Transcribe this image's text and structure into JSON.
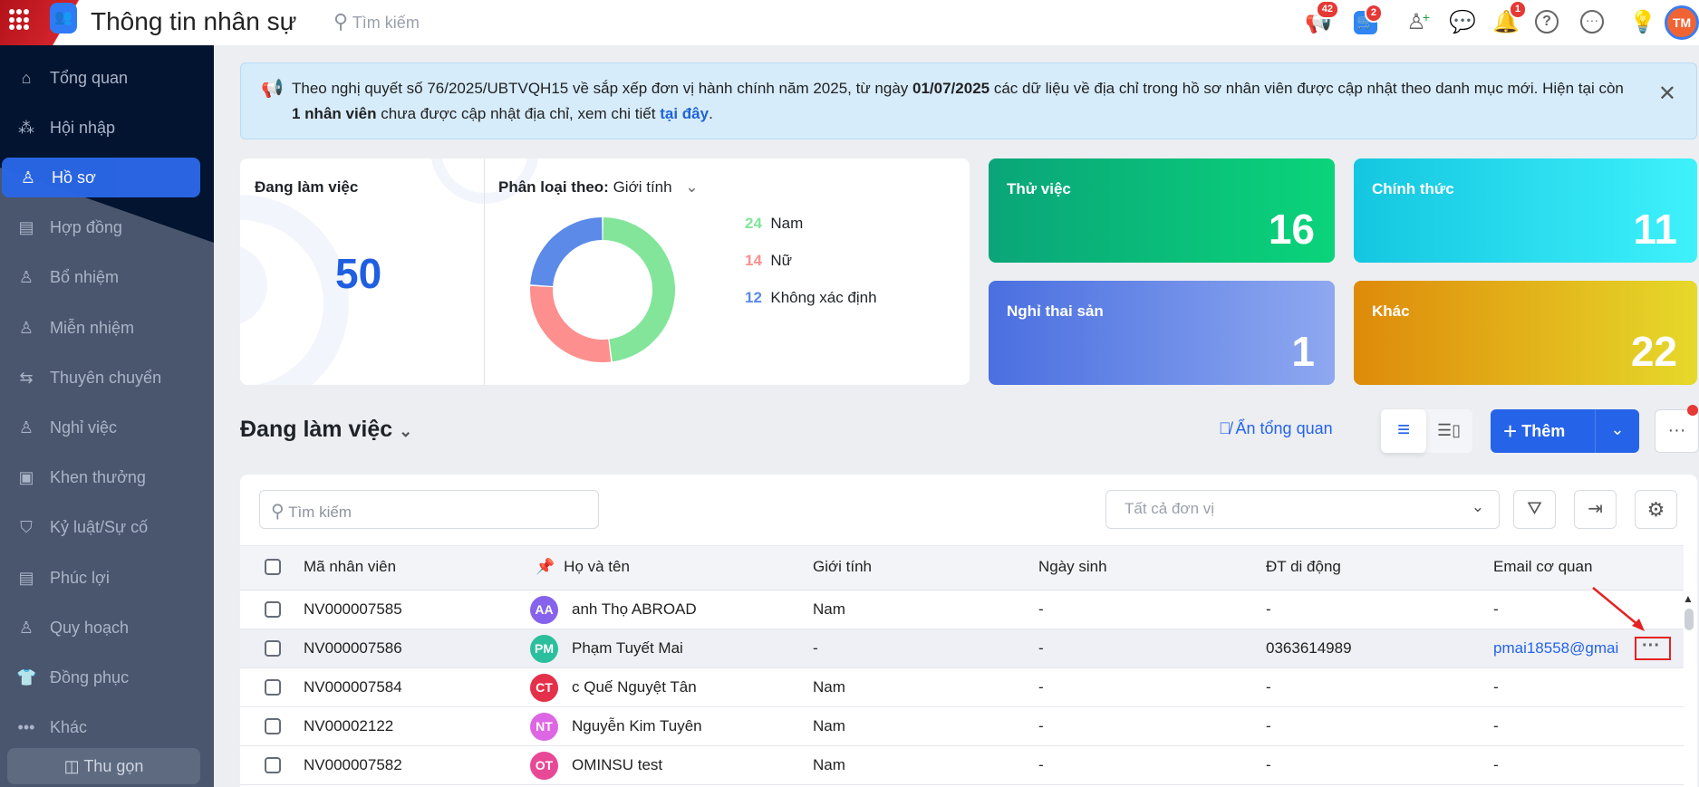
{
  "header": {
    "title": "Thông tin nhân sự",
    "search_placeholder": "Tìm kiếm",
    "badges": {
      "announcements": "42",
      "cart": "2",
      "notifications": "1"
    },
    "avatar_initials": "TM"
  },
  "sidebar": {
    "items": [
      {
        "label": "Tổng quan",
        "icon": "⌂"
      },
      {
        "label": "Hội nhập",
        "icon": "⁂"
      },
      {
        "label": "Hồ sơ",
        "icon": "♙"
      },
      {
        "label": "Hợp đồng",
        "icon": "▤"
      },
      {
        "label": "Bổ nhiệm",
        "icon": "♙"
      },
      {
        "label": "Miễn nhiệm",
        "icon": "♙"
      },
      {
        "label": "Thuyên chuyển",
        "icon": "⇆"
      },
      {
        "label": "Nghỉ việc",
        "icon": "♙"
      },
      {
        "label": "Khen thưởng",
        "icon": "▣"
      },
      {
        "label": "Kỷ luật/Sự cố",
        "icon": "⛉"
      },
      {
        "label": "Phúc lợi",
        "icon": "▤"
      },
      {
        "label": "Quy hoạch",
        "icon": "♙"
      },
      {
        "label": "Đồng phục",
        "icon": "👕"
      },
      {
        "label": "Khác",
        "icon": "•••"
      }
    ],
    "collapse_label": "Thu gọn"
  },
  "banner": {
    "text1": "Theo nghị quyết số 76/2025/UBTVQH15 về sắp xếp đơn vị hành chính năm 2025, từ ngày ",
    "date": "01/07/2025",
    "text2": " các dữ liệu về địa chỉ trong hồ sơ nhân viên được cập nhật theo danh mục mới. Hiện tại còn ",
    "count": "1 nhân viên",
    "text3": " chưa được cập nhật địa chỉ, xem chi tiết ",
    "link": "tại đây",
    "text4": "."
  },
  "summary": {
    "working_label": "Đang làm việc",
    "working_count": "50",
    "classify_label": "Phân loại theo:",
    "classify_value": "Giới tính"
  },
  "chart_data": {
    "type": "pie",
    "title": "Phân loại theo: Giới tính",
    "categories": [
      "Nam",
      "Nữ",
      "Không xác định"
    ],
    "values": [
      24,
      14,
      12
    ],
    "colors": [
      "#82e59a",
      "#fd8f8f",
      "#5b8ae8"
    ]
  },
  "status_cards": [
    {
      "label": "Thử việc",
      "value": "16",
      "colors": [
        "#0aa579",
        "#0ad47a"
      ]
    },
    {
      "label": "Chính thức",
      "value": "11",
      "colors": [
        "#15c6e0",
        "#3ef1fb"
      ]
    },
    {
      "label": "Nghỉ thai sản",
      "value": "1",
      "colors": [
        "#4a6fe0",
        "#8ea8f0"
      ]
    },
    {
      "label": "Khác",
      "value": "22",
      "colors": [
        "#de8a0a",
        "#e6d92a"
      ]
    }
  ],
  "section": {
    "title": "Đang làm việc",
    "hide_overview": "Ẩn tổng quan",
    "add_label": "Thêm"
  },
  "table": {
    "search_placeholder": "Tìm kiếm",
    "unit_placeholder": "Tất cả đơn vị",
    "columns": [
      "Mã nhân viên",
      "Họ và tên",
      "Giới tính",
      "Ngày sinh",
      "ĐT di động",
      "Email cơ quan"
    ],
    "rows": [
      {
        "id": "NV000007585",
        "initials": "AA",
        "color": "#8663ec",
        "name": "anh Thọ ABROAD",
        "gender": "Nam",
        "dob": "-",
        "phone": "-",
        "email": "-"
      },
      {
        "id": "NV000007586",
        "initials": "PM",
        "color": "#2bbf9d",
        "name": "Phạm Tuyết Mai",
        "gender": "-",
        "dob": "-",
        "phone": "0363614989",
        "email": "pmai18558@gmai"
      },
      {
        "id": "NV000007584",
        "initials": "CT",
        "color": "#e5304a",
        "name": "c Quế Nguyệt Tân",
        "gender": "Nam",
        "dob": "-",
        "phone": "-",
        "email": "-"
      },
      {
        "id": "NV00002122",
        "initials": "NT",
        "color": "#dd66e4",
        "name": "Nguyễn Kim Tuyên",
        "gender": "Nam",
        "dob": "-",
        "phone": "-",
        "email": "-"
      },
      {
        "id": "NV000007582",
        "initials": "OT",
        "color": "#e84896",
        "name": "OMINSU test",
        "gender": "Nam",
        "dob": "-",
        "phone": "-",
        "email": "-"
      }
    ]
  }
}
